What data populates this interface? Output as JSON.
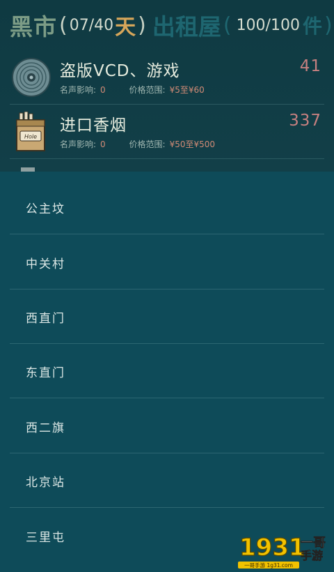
{
  "header": {
    "market_title": "黑市",
    "day_open": "(",
    "day_value": "07/40",
    "day_unit": "天",
    "day_close": ")",
    "rent_title": "出租屋",
    "cap_open": "(",
    "capacity_value": "100/100",
    "capacity_unit": "件",
    "cap_close": ")"
  },
  "goods": [
    {
      "name": "盗版VCD、游戏",
      "price": "41",
      "reputation_label": "名声影响:",
      "reputation_value": "0",
      "range_label": "价格范围:",
      "range_value": "¥5至¥60",
      "icon": "disc-icon"
    },
    {
      "name": "进口香烟",
      "price": "337",
      "reputation_label": "名声影响:",
      "reputation_value": "0",
      "range_label": "价格范围:",
      "range_value": "¥50至¥500",
      "icon": "cigarette-pack-icon"
    }
  ],
  "locations": [
    "公主坟",
    "中关村",
    "西直门",
    "东直门",
    "西二旗",
    "北京站",
    "三里屯"
  ],
  "watermark": {
    "brand_digits": "1931",
    "brand_name": "一哥手游",
    "brand_tagline": "一哥手游 1g31.com"
  },
  "colors": {
    "background": "#0f3d46",
    "dropdown": "#0e4b59",
    "divider": "#2c6672",
    "price": "#c68080",
    "header_market": "#7c9c86",
    "header_day_unit": "#d6a65a",
    "header_dim": "#1e6670"
  }
}
